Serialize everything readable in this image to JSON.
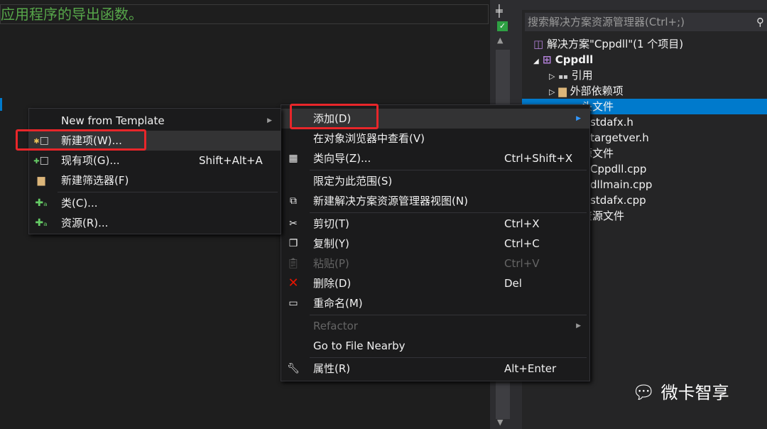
{
  "editor": {
    "code_comment": "应用程序的导出函数。"
  },
  "solution_explorer": {
    "search_placeholder": "搜索解决方案资源管理器(Ctrl+;)",
    "items": [
      {
        "label": "解决方案\"Cppdll\"(1 个项目)"
      },
      {
        "label": "Cppdll"
      },
      {
        "label": "引用"
      },
      {
        "label": "外部依赖项"
      },
      {
        "label": "头文件"
      },
      {
        "label": "stdafx.h"
      },
      {
        "label": "targetver.h"
      },
      {
        "label": "源文件"
      },
      {
        "label": "Cppdll.cpp"
      },
      {
        "label": "dllmain.cpp"
      },
      {
        "label": "stdafx.cpp"
      },
      {
        "label": "资源文件"
      }
    ]
  },
  "context_menu": {
    "items": [
      {
        "label": "添加(D)",
        "shortcut": ""
      },
      {
        "label": "在对象浏览器中查看(V)",
        "shortcut": ""
      },
      {
        "label": "类向导(Z)...",
        "shortcut": "Ctrl+Shift+X"
      },
      {
        "label": "限定为此范围(S)",
        "shortcut": ""
      },
      {
        "label": "新建解决方案资源管理器视图(N)",
        "shortcut": ""
      },
      {
        "label": "剪切(T)",
        "shortcut": "Ctrl+X"
      },
      {
        "label": "复制(Y)",
        "shortcut": "Ctrl+C"
      },
      {
        "label": "粘贴(P)",
        "shortcut": "Ctrl+V"
      },
      {
        "label": "删除(D)",
        "shortcut": "Del"
      },
      {
        "label": "重命名(M)",
        "shortcut": ""
      },
      {
        "label": "Refactor",
        "shortcut": ""
      },
      {
        "label": "Go to File Nearby",
        "shortcut": ""
      },
      {
        "label": "属性(R)",
        "shortcut": "Alt+Enter"
      }
    ]
  },
  "add_submenu": {
    "items": [
      {
        "label": "New from Template",
        "shortcut": ""
      },
      {
        "label": "新建项(W)...",
        "shortcut": ""
      },
      {
        "label": "现有项(G)...",
        "shortcut": "Shift+Alt+A"
      },
      {
        "label": "新建筛选器(F)",
        "shortcut": ""
      },
      {
        "label": "类(C)...",
        "shortcut": ""
      },
      {
        "label": "资源(R)...",
        "shortcut": ""
      }
    ]
  },
  "watermark": {
    "text": "微卡智享"
  },
  "colors": {
    "selection": "#007acc",
    "highlight_box": "#e8262a",
    "comment": "#57a64a"
  }
}
